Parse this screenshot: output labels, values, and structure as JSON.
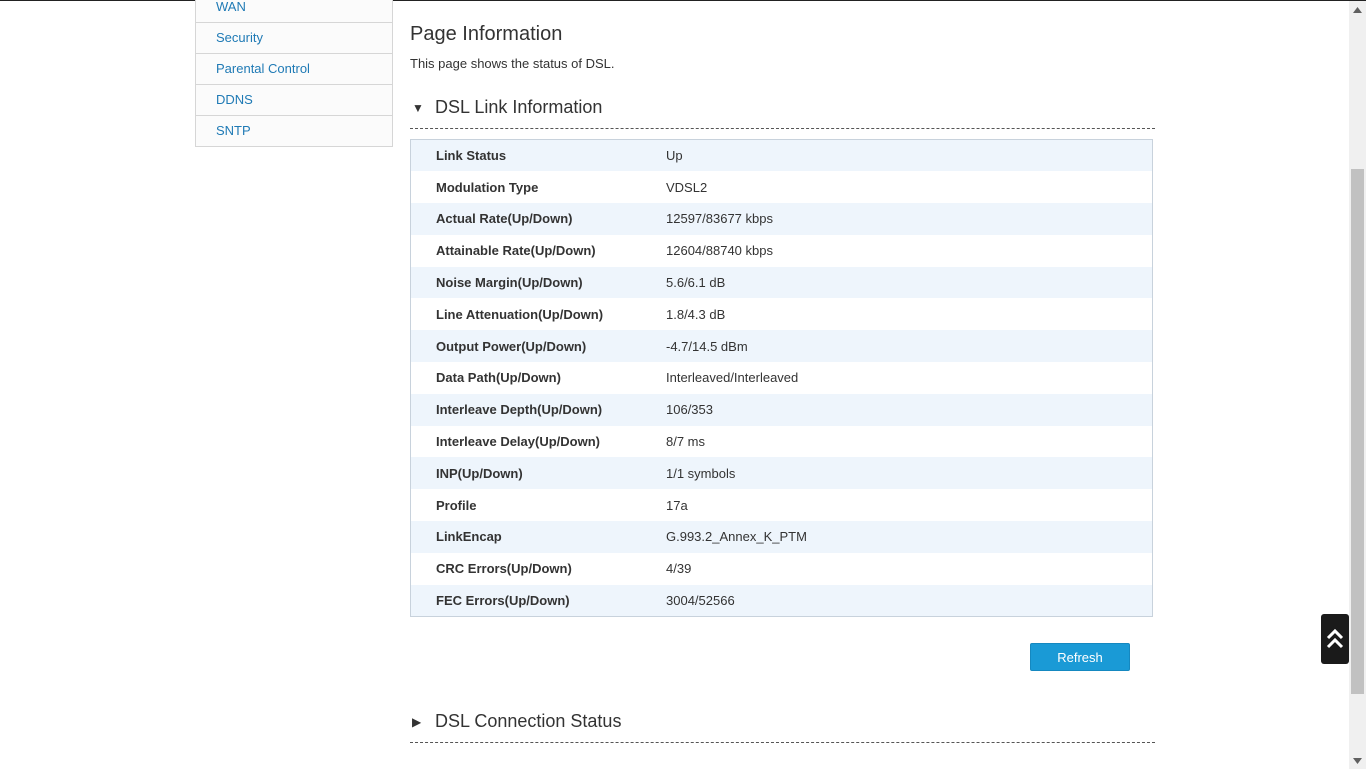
{
  "sidebar": {
    "items": [
      {
        "label": "WAN"
      },
      {
        "label": "Security"
      },
      {
        "label": "Parental Control"
      },
      {
        "label": "DDNS"
      },
      {
        "label": "SNTP"
      }
    ]
  },
  "page": {
    "title": "Page Information",
    "description": "This page shows the status of DSL."
  },
  "dsl_link": {
    "section_title": "DSL Link Information",
    "rows": [
      {
        "label": "Link Status",
        "value": "Up"
      },
      {
        "label": "Modulation Type",
        "value": "VDSL2"
      },
      {
        "label": "Actual Rate(Up/Down)",
        "value": "12597/83677 kbps"
      },
      {
        "label": "Attainable Rate(Up/Down)",
        "value": "12604/88740 kbps"
      },
      {
        "label": "Noise Margin(Up/Down)",
        "value": "5.6/6.1 dB"
      },
      {
        "label": "Line Attenuation(Up/Down)",
        "value": "1.8/4.3 dB"
      },
      {
        "label": "Output Power(Up/Down)",
        "value": "-4.7/14.5 dBm"
      },
      {
        "label": "Data Path(Up/Down)",
        "value": "Interleaved/Interleaved"
      },
      {
        "label": "Interleave Depth(Up/Down)",
        "value": "106/353"
      },
      {
        "label": "Interleave Delay(Up/Down)",
        "value": "8/7 ms"
      },
      {
        "label": "INP(Up/Down)",
        "value": "1/1 symbols"
      },
      {
        "label": "Profile",
        "value": "17a"
      },
      {
        "label": "LinkEncap",
        "value": "G.993.2_Annex_K_PTM"
      },
      {
        "label": "CRC Errors(Up/Down)",
        "value": "4/39"
      },
      {
        "label": "FEC Errors(Up/Down)",
        "value": "3004/52566"
      }
    ],
    "refresh_label": "Refresh"
  },
  "dsl_connection": {
    "section_title": "DSL Connection Status"
  },
  "colors": {
    "link": "#1f7ab5",
    "button": "#1a9ad6",
    "row_alt": "#eef5fc"
  },
  "icons": {
    "expanded": "triangle-down-icon",
    "collapsed": "triangle-right-icon",
    "back_to_top": "double-chevron-up-icon"
  }
}
